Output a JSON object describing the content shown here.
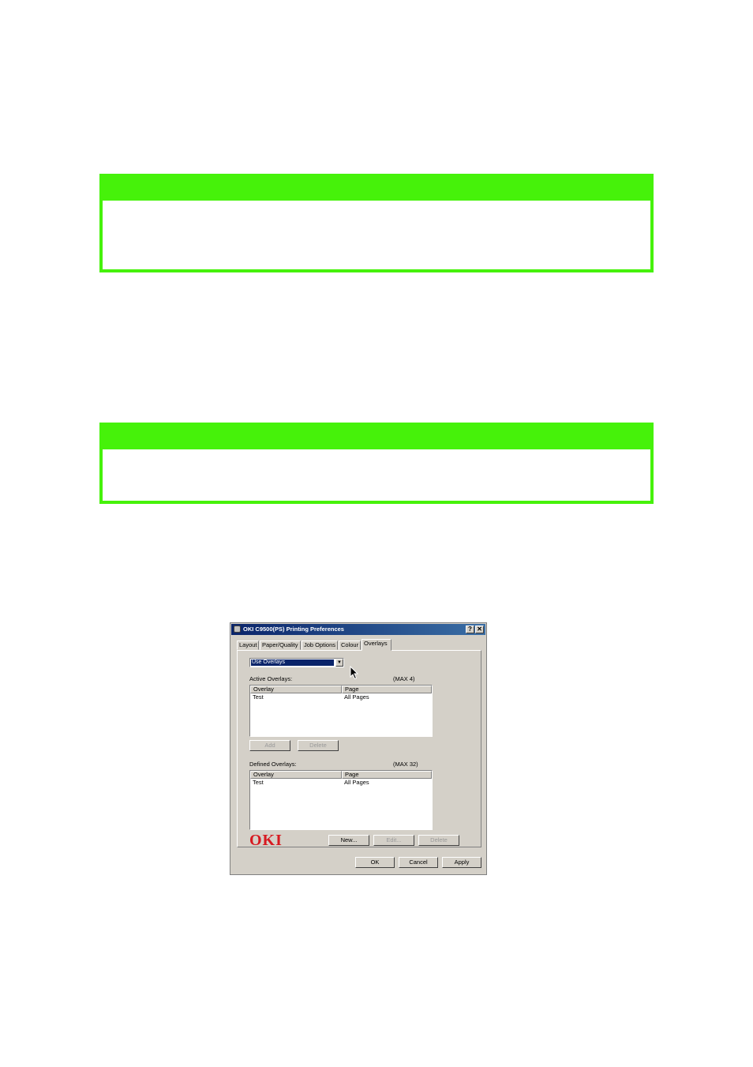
{
  "notes": [
    {},
    {}
  ],
  "dialog": {
    "title": "OKI C9500(PS) Printing Preferences",
    "help_button": "?",
    "close_button": "✕",
    "tabs": [
      {
        "label": "Layout"
      },
      {
        "label": "Paper/Quality"
      },
      {
        "label": "Job Options"
      },
      {
        "label": "Colour"
      },
      {
        "label": "Overlays"
      }
    ],
    "overlay_mode": {
      "selected": "Use Overlays"
    },
    "active_overlays": {
      "label": "Active Overlays:",
      "max": "(MAX 4)",
      "columns": [
        "Overlay",
        "Page"
      ],
      "rows": [
        {
          "overlay": "Test",
          "page": "All Pages"
        }
      ]
    },
    "add_button": "Add",
    "delete_active_button": "Delete",
    "defined_overlays": {
      "label": "Defined Overlays:",
      "max": "(MAX 32)",
      "columns": [
        "Overlay",
        "Page"
      ],
      "rows": [
        {
          "overlay": "Test",
          "page": "All Pages"
        }
      ]
    },
    "logo_text": "OKI",
    "new_button": "New...",
    "edit_button": "Edit...",
    "delete_defined_button": "Delete",
    "ok_button": "OK",
    "cancel_button": "Cancel",
    "apply_button": "Apply"
  },
  "colors": {
    "note_border": "#46f20a",
    "title_bar": "#0a246a",
    "logo": "#d71920",
    "dialog_face": "#d4d0c8"
  }
}
